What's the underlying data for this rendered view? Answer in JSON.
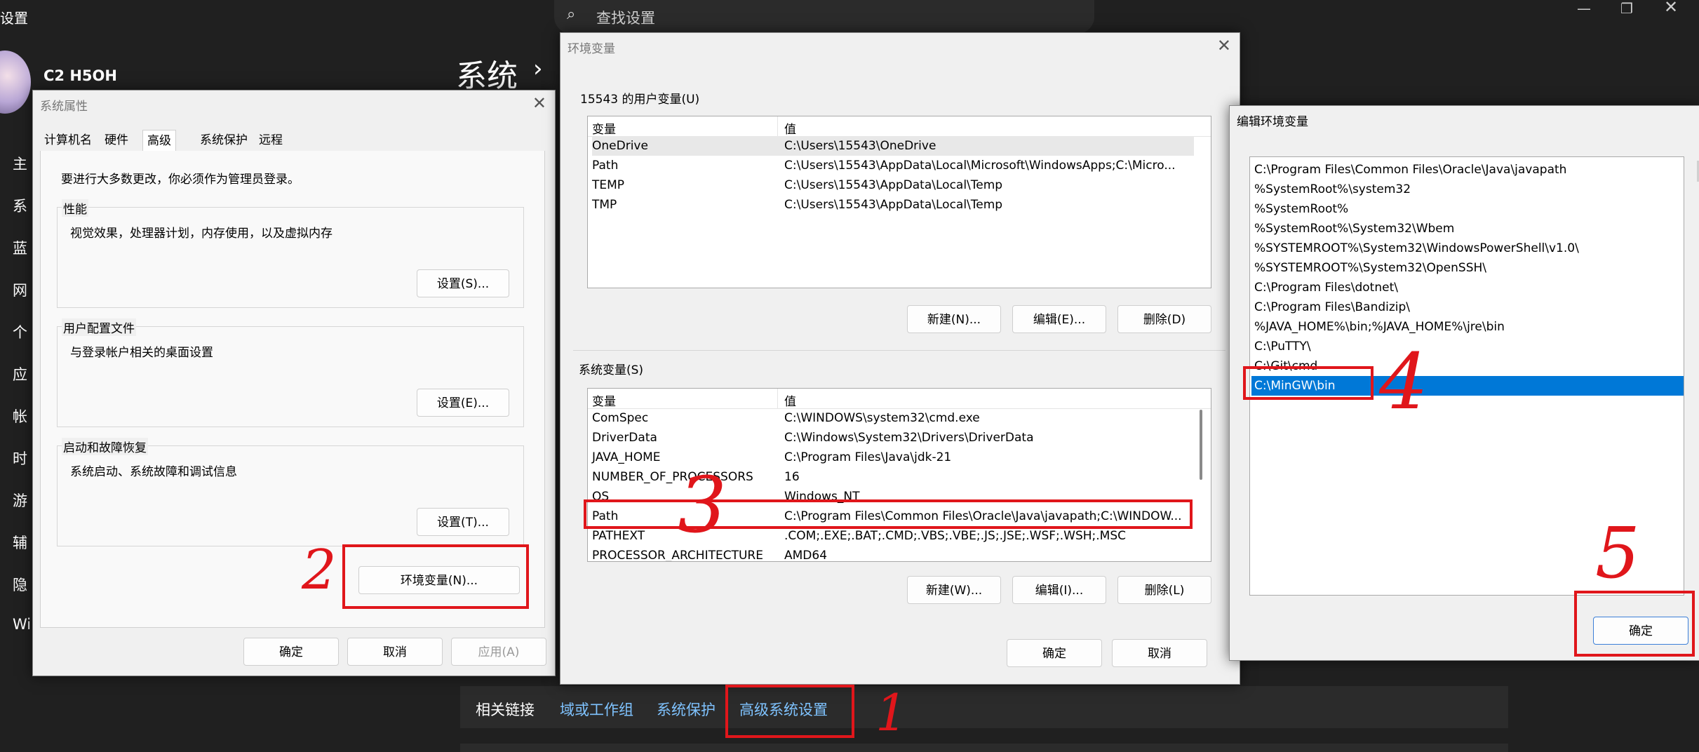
{
  "settings": {
    "window_title": "设置",
    "search_placeholder": "查找设置",
    "user_name": "C2 H5OH",
    "section_title": "系统",
    "section_chevron": "›",
    "sidebar": [
      "主",
      "系",
      "蓝",
      "网",
      "个",
      "应",
      "帐",
      "时",
      "游",
      "辅",
      "隐",
      "Wi"
    ],
    "related_links": {
      "label": "相关链接",
      "items": [
        "域或工作组",
        "系统保护",
        "高级系统设置"
      ]
    }
  },
  "sysprops": {
    "title": "系统属性",
    "tabs": [
      "计算机名",
      "硬件",
      "高级",
      "系统保护",
      "远程"
    ],
    "admin_note": "要进行大多数更改，你必须作为管理员登录。",
    "perf": {
      "label": "性能",
      "desc": "视觉效果，处理器计划，内存使用，以及虚拟内存",
      "button": "设置(S)..."
    },
    "profile": {
      "label": "用户配置文件",
      "desc": "与登录帐户相关的桌面设置",
      "button": "设置(E)..."
    },
    "startup": {
      "label": "启动和故障恢复",
      "desc": "系统启动、系统故障和调试信息",
      "button": "设置(T)..."
    },
    "env_button": "环境变量(N)...",
    "ok": "确定",
    "cancel": "取消",
    "apply": "应用(A)"
  },
  "envvars": {
    "title": "环境变量",
    "user_group": "15543 的用户变量(U)",
    "col_var": "变量",
    "col_val": "值",
    "user_vars": [
      [
        "OneDrive",
        "C:\\Users\\15543\\OneDrive"
      ],
      [
        "Path",
        "C:\\Users\\15543\\AppData\\Local\\Microsoft\\WindowsApps;C:\\Micro..."
      ],
      [
        "TEMP",
        "C:\\Users\\15543\\AppData\\Local\\Temp"
      ],
      [
        "TMP",
        "C:\\Users\\15543\\AppData\\Local\\Temp"
      ]
    ],
    "user_buttons": [
      "新建(N)...",
      "编辑(E)...",
      "删除(D)"
    ],
    "sys_group": "系统变量(S)",
    "sys_vars": [
      [
        "ComSpec",
        "C:\\WINDOWS\\system32\\cmd.exe"
      ],
      [
        "DriverData",
        "C:\\Windows\\System32\\Drivers\\DriverData"
      ],
      [
        "JAVA_HOME",
        "C:\\Program Files\\Java\\jdk-21"
      ],
      [
        "NUMBER_OF_PROCESSORS",
        "16"
      ],
      [
        "OS",
        "Windows_NT"
      ],
      [
        "Path",
        "C:\\Program Files\\Common Files\\Oracle\\Java\\javapath;C:\\WINDOW..."
      ],
      [
        "PATHEXT",
        ".COM;.EXE;.BAT;.CMD;.VBS;.VBE;.JS;.JSE;.WSF;.WSH;.MSC"
      ],
      [
        "PROCESSOR_ARCHITECTURE",
        "AMD64"
      ]
    ],
    "sys_buttons": [
      "新建(W)...",
      "编辑(I)...",
      "删除(L)"
    ],
    "ok": "确定",
    "cancel": "取消"
  },
  "editenv": {
    "title": "编辑环境变量",
    "entries": [
      "C:\\Program Files\\Common Files\\Oracle\\Java\\javapath",
      "%SystemRoot%\\system32",
      "%SystemRoot%",
      "%SystemRoot%\\System32\\Wbem",
      "%SYSTEMROOT%\\System32\\WindowsPowerShell\\v1.0\\",
      "%SYSTEMROOT%\\System32\\OpenSSH\\",
      "C:\\Program Files\\dotnet\\",
      "C:\\Program Files\\Bandizip\\",
      "%JAVA_HOME%\\bin;%JAVA_HOME%\\jre\\bin",
      "C:\\PuTTY\\",
      "C:\\Git\\cmd",
      "C:\\MinGW\\bin"
    ],
    "selected_index": 11,
    "ok": "确定"
  },
  "annotations": {
    "n1": "1",
    "n2": "2",
    "n3": "3",
    "n4": "4",
    "n5": "5"
  },
  "colors": {
    "annotation": "#e0161b",
    "selection": "#0078d7",
    "link": "#7fc3ff"
  }
}
